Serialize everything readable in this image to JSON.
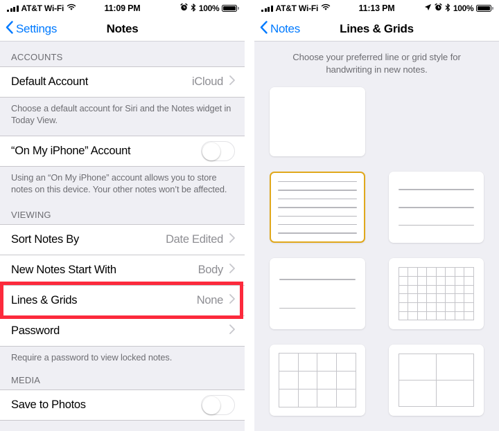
{
  "left": {
    "status": {
      "carrier": "AT&T Wi-Fi",
      "time": "11:09 PM",
      "battery_pct": "100%",
      "signal_icon": "signal-bars-icon",
      "wifi_icon": "wifi-icon",
      "alarm_icon": "alarm-clock-icon",
      "bluetooth_icon": "bluetooth-icon",
      "battery_icon": "battery-full-icon"
    },
    "nav": {
      "back_label": "Settings",
      "title": "Notes",
      "back_icon": "chevron-left-icon"
    },
    "sections": [
      {
        "header": "ACCOUNTS",
        "rows": [
          {
            "label": "Default Account",
            "value": "iCloud",
            "accessory": "chevron-right-icon"
          }
        ],
        "footnote": "Choose a default account for Siri and the Notes widget in Today View."
      },
      {
        "header": "",
        "rows": [
          {
            "label": "“On My iPhone” Account",
            "value": "",
            "accessory": "toggle-off"
          }
        ],
        "footnote": "Using an “On My iPhone” account allows you to store notes on this device. Your other notes won’t be affected."
      },
      {
        "header": "VIEWING",
        "rows": [
          {
            "label": "Sort Notes By",
            "value": "Date Edited",
            "accessory": "chevron-right-icon"
          },
          {
            "label": "New Notes Start With",
            "value": "Body",
            "accessory": "chevron-right-icon"
          },
          {
            "label": "Lines & Grids",
            "value": "None",
            "accessory": "chevron-right-icon",
            "highlighted": true
          },
          {
            "label": "Password",
            "value": "",
            "accessory": "chevron-right-icon"
          }
        ],
        "footnote": "Require a password to view locked notes."
      },
      {
        "header": "MEDIA",
        "rows": [
          {
            "label": "Save to Photos",
            "value": "",
            "accessory": "toggle-off"
          }
        ],
        "footnote": ""
      }
    ],
    "highlight_color": "#fc2a3c"
  },
  "right": {
    "status": {
      "carrier": "AT&T Wi-Fi",
      "time": "11:13 PM",
      "battery_pct": "100%",
      "signal_icon": "signal-bars-icon",
      "wifi_icon": "wifi-icon",
      "location_icon": "location-arrow-icon",
      "alarm_icon": "alarm-clock-icon",
      "bluetooth_icon": "bluetooth-icon",
      "battery_icon": "battery-full-icon"
    },
    "nav": {
      "back_label": "Notes",
      "title": "Lines & Grids",
      "back_icon": "chevron-left-icon"
    },
    "intro": "Choose your preferred line or grid style for handwriting in new notes.",
    "selected_color": "#e0a81c",
    "options": [
      {
        "id": "none",
        "name": "No lines or grid",
        "style": "blank",
        "selected": false
      },
      {
        "id": "lines-narrow",
        "name": "Narrow ruled lines",
        "style": "lines",
        "count": 7,
        "spacing": "narrow",
        "selected": true
      },
      {
        "id": "lines-wide",
        "name": "Wide ruled lines",
        "style": "lines",
        "count": 3,
        "spacing": "wide",
        "selected": false
      },
      {
        "id": "lines-xwide",
        "name": "Extra wide lines",
        "style": "lines",
        "count": 2,
        "spacing": "xwide",
        "selected": false
      },
      {
        "id": "grid-small",
        "name": "Small grid",
        "style": "grid",
        "cols": 8,
        "rows": 6,
        "size": "small",
        "selected": false
      },
      {
        "id": "grid-medium",
        "name": "Medium grid",
        "style": "grid",
        "cols": 4,
        "rows": 3,
        "size": "medium",
        "selected": false
      },
      {
        "id": "grid-large",
        "name": "Large grid",
        "style": "grid",
        "cols": 2,
        "rows": 2,
        "size": "large",
        "selected": false
      }
    ]
  }
}
